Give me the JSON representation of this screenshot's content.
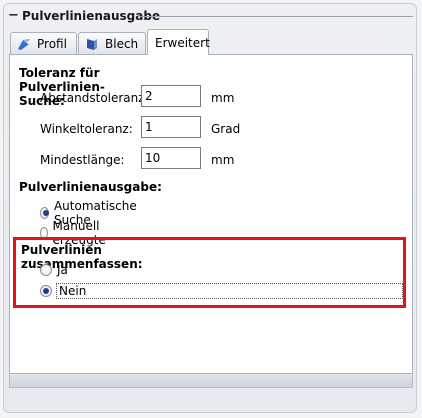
{
  "group": {
    "title": "Pulverlinienausgabe",
    "collapse_symbol": "−"
  },
  "tabs": [
    {
      "label": "Profil",
      "icon": "profile-icon"
    },
    {
      "label": "Blech",
      "icon": "sheet-metal-icon"
    },
    {
      "label": "Erweitert",
      "active": true
    }
  ],
  "tolerance": {
    "heading": "Toleranz für Pulverlinien-Suche:",
    "distance": {
      "label": "Abstandstoleranz:",
      "value": "2",
      "unit": "mm"
    },
    "angle": {
      "label": "Winkeltoleranz:",
      "value": "1",
      "unit": "Grad"
    },
    "min_length": {
      "label": "Mindestlänge:",
      "value": "10",
      "unit": "mm"
    }
  },
  "output": {
    "heading": "Pulverlinienausgabe:",
    "options": [
      {
        "label": "Automatische Suche",
        "checked": true
      },
      {
        "label": "Manuell erzeugte",
        "checked": false
      }
    ]
  },
  "merge": {
    "heading": "Pulverlinien zusammenfassen:",
    "options": [
      {
        "label": "Ja",
        "checked": false
      },
      {
        "label": "Nein",
        "checked": true
      }
    ]
  },
  "colors": {
    "highlight": "#e2131b",
    "radio_dot": "#1f3f8f"
  }
}
